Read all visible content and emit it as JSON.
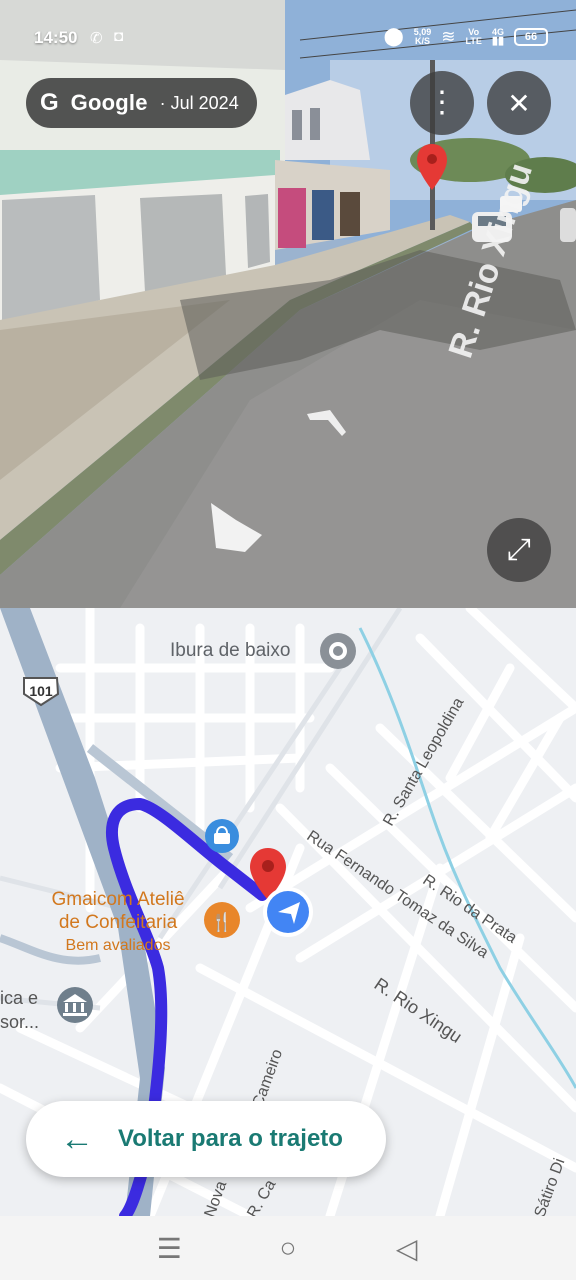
{
  "status_bar": {
    "time": "14:50",
    "speed_value": "5,09",
    "speed_unit": "K/S",
    "net_top": "Vo",
    "net_bottom": "LTE",
    "net_gen": "4G",
    "battery": "66"
  },
  "street_view": {
    "brand": "Google",
    "date": "· Jul 2024",
    "street_label": "R. Rio Xingu",
    "icons": [
      "google-g-icon",
      "more-vert-icon",
      "close-icon",
      "expand-icon",
      "red-pin-icon",
      "nav-chevron-icon"
    ]
  },
  "map": {
    "road_number": "101",
    "place_neighborhood": "Ibura de baixo",
    "poi_name_line1": "Gmaicom Ateliê",
    "poi_name_line2": "de Confeitaria",
    "poi_subtitle": "Bem avaliados",
    "partial_place_line1": "ica e",
    "partial_place_line2": "sor...",
    "streets": {
      "santa_leopoldina": "R. Santa Leopoldina",
      "fernando_tomaz": "Rua Fernando Tomaz da Silva",
      "rio_da_prata": "R. Rio da Prata",
      "rio_xingu": "R. Rio Xingu",
      "cameiro": "Cameiro",
      "nova": "Nova",
      "r_ca": "R. Ca",
      "satiro": "Sátiro Di"
    },
    "back_button": "Voltar para o trajeto",
    "colors": {
      "route": "#3b2be0",
      "poi": "#e8862a",
      "pin": "#e53935",
      "location": "#4285f4",
      "button_text": "#1a7a73"
    }
  },
  "nav": {
    "recent_icon": "☰",
    "home_icon": "○",
    "back_icon": "◁"
  }
}
